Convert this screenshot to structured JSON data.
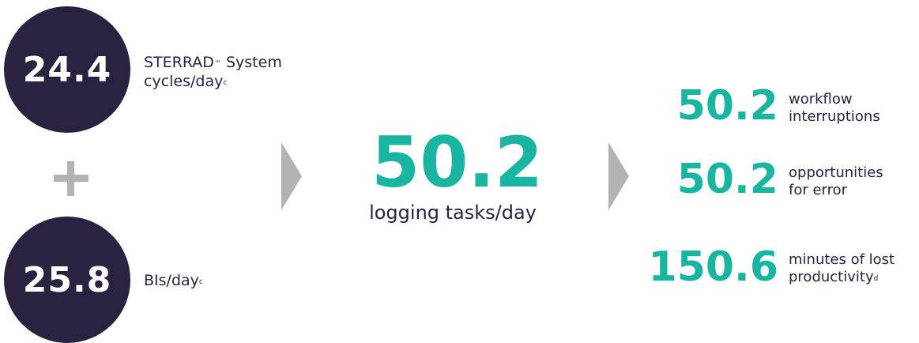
{
  "inputs": [
    {
      "value": "24.4",
      "label_main": "STERRAD",
      "label_mark": "™",
      "label_rest": " System",
      "label_line2": "cycles/day",
      "label_sup": "c"
    },
    {
      "value": "25.8",
      "label_line1": "BIs/day",
      "label_sup": "c"
    }
  ],
  "operator": "+",
  "total": {
    "value": "50.2",
    "label": "logging tasks/day"
  },
  "outcomes": [
    {
      "value": "50.2",
      "line1": "workflow",
      "line2": "interruptions",
      "sup": ""
    },
    {
      "value": "50.2",
      "line1": "opportunities",
      "line2": "for error",
      "sup": ""
    },
    {
      "value": "150.6",
      "line1": "minutes of lost",
      "line2": "productivity",
      "sup": "d"
    }
  ],
  "colors": {
    "circle": "#2b2140",
    "accent": "#1ab5a0",
    "text": "#2b2140",
    "muted": "#b3b3b3"
  },
  "icons": {
    "plus": "plus-icon",
    "arrow": "chevron-right-icon"
  }
}
